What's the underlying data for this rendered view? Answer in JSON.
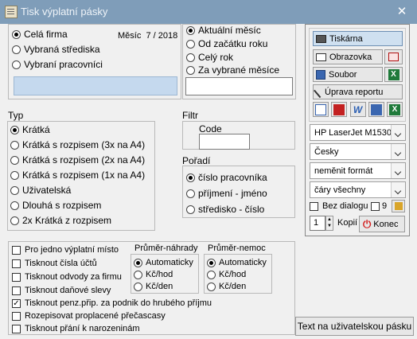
{
  "window": {
    "title": "Tisk výplatní pásky",
    "close_glyph": "✕"
  },
  "scope": {
    "options": [
      "Celá firma",
      "Vybraná střediska",
      "Vybraní pracovníci"
    ],
    "selected": 0,
    "month_label": "Měsíc",
    "month_value": "7 / 2018"
  },
  "period": {
    "options": [
      "Aktuální měsíc",
      "Od začátku roku",
      "Celý rok",
      "Za vybrané měsíce"
    ],
    "selected": 0
  },
  "typ": {
    "label": "Typ",
    "options": [
      "Krátká",
      "Krátká s rozpisem (3x na A4)",
      "Krátká s rozpisem (2x na A4)",
      "Krátká s rozpisem (1x na A4)",
      "Uživatelská",
      "Dlouhá s rozpisem",
      "2x Krátká z rozpisem"
    ],
    "selected": 0
  },
  "filtr": {
    "label": "Filtr",
    "code_label": "Code"
  },
  "poradi": {
    "label": "Pořadí",
    "options": [
      "číslo pracovníka",
      "příjmení - jméno",
      "středisko - číslo"
    ],
    "selected": 0
  },
  "checks": [
    {
      "label": "Pro jedno výplatní místo",
      "checked": false
    },
    {
      "label": "Tisknout čísla účtů",
      "checked": false
    },
    {
      "label": "Tisknout odvody za firmu",
      "checked": false
    },
    {
      "label": "Tisknout daňové slevy",
      "checked": false
    },
    {
      "label": "Tisknout penz.přip. za podnik do hrubého příjmu",
      "checked": true
    },
    {
      "label": "Rozepisovat proplacené přečascasy",
      "checked": false
    },
    {
      "label": "Tisknout přání k narozeninám",
      "checked": false
    }
  ],
  "prumer_nahrady": {
    "label": "Průměr-náhrady",
    "options": [
      "Automaticky",
      "Kč/hod",
      "Kč/den"
    ],
    "selected": 0
  },
  "prumer_nemoc": {
    "label": "Průměr-nemoc",
    "options": [
      "Automaticky",
      "Kč/hod",
      "Kč/den"
    ],
    "selected": 0
  },
  "output": {
    "tiskarna": "Tiskárna",
    "obrazovka": "Obrazovka",
    "soubor": "Soubor",
    "uprava": "Úprava reportu",
    "printer": "HP LaserJet M1530",
    "language": "Česky",
    "format": "neměnit formát",
    "lines": "čáry všechny",
    "bez_dialogu": "Bez dialogu",
    "bez_dialogu_checked": false,
    "nine_label": "9",
    "nine_checked": false,
    "copies_value": "1",
    "copies_label": "Kopií",
    "konec": "Konec"
  },
  "user_text_button": "Text na uživatelskou pásku",
  "icons": {
    "app": "document-icon",
    "tiskarna": "printer-icon",
    "obrazovka": "monitor-icon",
    "soubor": "disk-icon",
    "email": "email-icon",
    "excel": "excel-icon",
    "uprava": "edit-wand-icon",
    "export": [
      "table-icon",
      "pdf-icon",
      "word-icon",
      "html-icon",
      "excel-icon"
    ],
    "konec": "power-icon"
  },
  "colors": {
    "titlebar": "#7f9db9",
    "highlight": "#c5d9ee",
    "konec_red": "#d42020"
  }
}
